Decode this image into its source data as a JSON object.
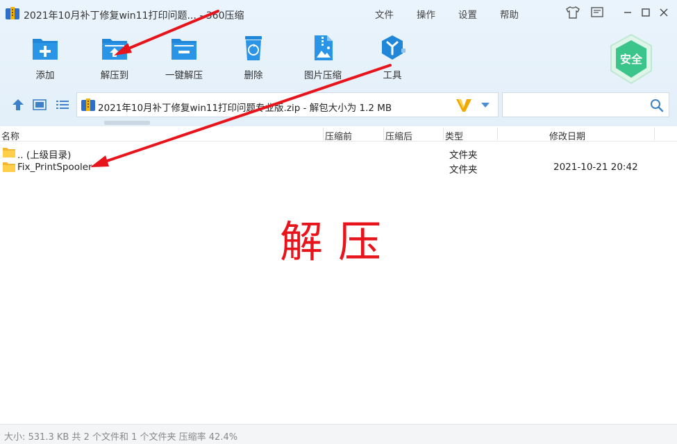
{
  "window": {
    "title": "2021年10月补丁修复win11打印问题... - 360压缩"
  },
  "menu": {
    "file": "文件",
    "operate": "操作",
    "settings": "设置",
    "help": "帮助"
  },
  "toolbar": {
    "add": "添加",
    "extract_to": "解压到",
    "one_click_extract": "一键解压",
    "delete": "删除",
    "image_compress": "图片压缩",
    "tools": "工具"
  },
  "badge": {
    "safe": "安全"
  },
  "path": {
    "text": "2021年10月补丁修复win11打印问题专业版.zip - 解包大小为 1.2 MB"
  },
  "search": {
    "value": "",
    "placeholder": ""
  },
  "columns": {
    "name": "名称",
    "before": "压缩前",
    "after": "压缩后",
    "type": "类型",
    "modified": "修改日期"
  },
  "rows": [
    {
      "name": ".. (上级目录)",
      "type": "文件夹",
      "modified": ""
    },
    {
      "name": "Fix_PrintSpooler",
      "type": "文件夹",
      "modified": "2021-10-21 20:42"
    }
  ],
  "annotation": {
    "text": "解压"
  },
  "status": {
    "text": "大小: 531.3 KB 共 2 个文件和 1 个文件夹 压缩率 42.4%"
  },
  "colors": {
    "accent": "#1f86d8",
    "annotation_red": "#e8141b",
    "safe_green": "#3cc58a"
  }
}
